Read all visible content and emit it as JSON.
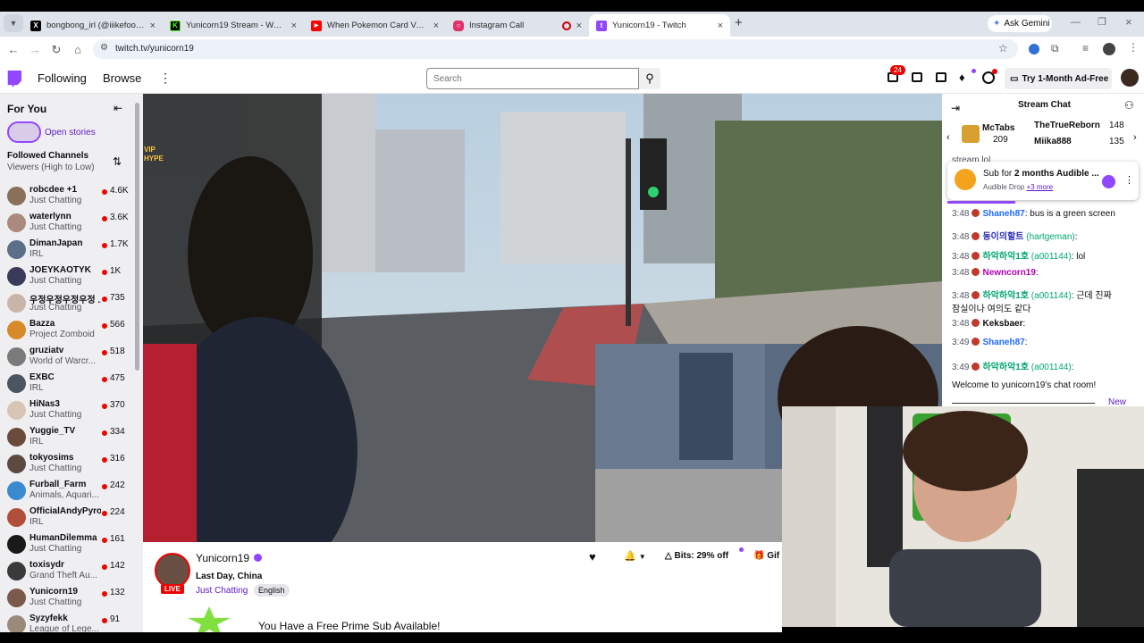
{
  "browser": {
    "tabs": [
      {
        "title": "bongbong_irl (@iiikefoodmany",
        "favicon": "x-icon",
        "active": false
      },
      {
        "title": "Yunicorn19 Stream - Watch Liv",
        "favicon": "kick-icon",
        "active": false
      },
      {
        "title": "When Pokemon Card Vendors",
        "favicon": "youtube-icon",
        "active": false
      },
      {
        "title": "Instagram Call",
        "favicon": "instagram-icon",
        "active": false
      },
      {
        "title": "Yunicorn19 - Twitch",
        "favicon": "twitch-icon",
        "active": true
      }
    ],
    "new_tab": "+",
    "ask_gemini": "Ask Gemini",
    "url": "twitch.tv/yunicorn19"
  },
  "twitch_nav": {
    "following": "Following",
    "browse": "Browse",
    "search_placeholder": "Search",
    "notif_count": "24",
    "ad_free": "Try 1-Month Ad-Free"
  },
  "sidebar": {
    "for_you": "For You",
    "open_stories": "Open stories",
    "followed_title": "Followed Channels",
    "followed_sort": "Viewers (High to Low)",
    "channels": [
      {
        "name": "robcdee +1",
        "game": "Just Chatting",
        "viewers": "4.6K",
        "color": "#8a6f5a"
      },
      {
        "name": "waterlynn",
        "game": "Just Chatting",
        "viewers": "3.6K",
        "color": "#a98a7c"
      },
      {
        "name": "DimanJapan",
        "game": "IRL",
        "viewers": "1.7K",
        "color": "#5b6e8a"
      },
      {
        "name": "JOEYKAOTYK",
        "game": "Just Chatting",
        "viewers": "1K",
        "color": "#3a3a5a"
      },
      {
        "name": "우정우정우정우정 ...",
        "game": "Just Chatting",
        "viewers": "735",
        "color": "#c9b5a8"
      },
      {
        "name": "Bazza",
        "game": "Project Zomboid",
        "viewers": "566",
        "color": "#d88a2a"
      },
      {
        "name": "gruziatv",
        "game": "World of Warcr...",
        "viewers": "518",
        "color": "#7a7a7a"
      },
      {
        "name": "EXBC",
        "game": "IRL",
        "viewers": "475",
        "color": "#4a5560"
      },
      {
        "name": "HiNas3",
        "game": "Just Chatting",
        "viewers": "370",
        "color": "#d9c5b5"
      },
      {
        "name": "Yuggie_TV",
        "game": "IRL",
        "viewers": "334",
        "color": "#6a4a3a"
      },
      {
        "name": "tokyosims",
        "game": "Just Chatting",
        "viewers": "316",
        "color": "#5a4a40"
      },
      {
        "name": "Furball_Farm",
        "game": "Animals, Aquari...",
        "viewers": "242",
        "color": "#3a8ad0"
      },
      {
        "name": "OfficialAndyPyro",
        "game": "IRL",
        "viewers": "224",
        "color": "#b0503a"
      },
      {
        "name": "HumanDilemma",
        "game": "Just Chatting",
        "viewers": "161",
        "color": "#1a1a1a"
      },
      {
        "name": "toxisydr",
        "game": "Grand Theft Au...",
        "viewers": "142",
        "color": "#3a3a3a"
      },
      {
        "name": "Yunicorn19",
        "game": "Just Chatting",
        "viewers": "132",
        "color": "#7a5a4a"
      },
      {
        "name": "Syzyfekk",
        "game": "League of Lege...",
        "viewers": "91",
        "color": "#9a8a7a"
      }
    ]
  },
  "stream": {
    "vip_badge": "VIP HYPE",
    "streamer": "Yunicorn19",
    "live": "LIVE",
    "title": "Last Day, China",
    "category": "Just Chatting",
    "tag": "English",
    "bits": "Bits: 29% off",
    "gift": "Gif",
    "prime": "You Have a Free Prime Sub Available!"
  },
  "chat": {
    "header": "Stream Chat",
    "leaderboard": [
      {
        "name": "McTabs",
        "score": "209"
      },
      {
        "name": "TheTrueReborn",
        "score": "148"
      },
      {
        "name": "Miika888",
        "score": "135"
      }
    ],
    "partial_line": "stream lol",
    "drop": {
      "prefix": "Sub for ",
      "bold": "2 months Audible ...",
      "sub": "Audible Drop",
      "more": "+3 more"
    },
    "messages": [
      {
        "time": "3:48",
        "user": "Shaneh87",
        "color": "#1e69ff",
        "text": ": bus is a green screen"
      },
      {
        "time": "3:48",
        "user": "동이의할트",
        "alt": " (hartgeman)",
        "color": "#2e2eb8",
        "text": ":"
      },
      {
        "time": "3:48",
        "user": "하악하악1호",
        "alt": " (a001144)",
        "color": "#00a86b",
        "text": ": lol"
      },
      {
        "time": "3:48",
        "user": "Newncorn19",
        "color": "#b000b0",
        "text": ":"
      },
      {
        "time": "3:48",
        "user": "하악하악1호",
        "alt": " (a001144)",
        "color": "#00a86b",
        "text": ": 근데 진짜"
      },
      {
        "time": "",
        "user": "",
        "color": "#000",
        "text": "잠실이나 여의도 같다"
      },
      {
        "time": "3:48",
        "user": "Keksbaer",
        "color": "#0e0e10",
        "text": ":"
      },
      {
        "time": "3:49",
        "user": "Shaneh87",
        "color": "#1e69ff",
        "text": ":"
      },
      {
        "time": "3:49",
        "user": "하악하악1호",
        "alt": " (a001144)",
        "color": "#00a86b",
        "text": ":"
      }
    ],
    "welcome": "Welcome to yunicorn19's chat room!",
    "new_label": "New"
  },
  "colors": {
    "twitch_purple": "#9146ff",
    "live_red": "#eb0400"
  }
}
